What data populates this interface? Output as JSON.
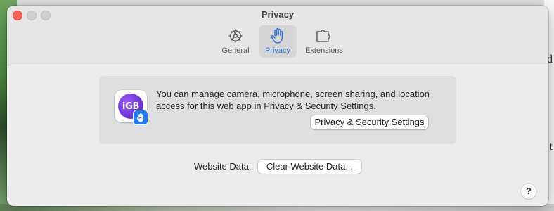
{
  "window": {
    "title": "Privacy"
  },
  "tabs": [
    {
      "label": "General",
      "icon": "gear-icon",
      "active": false
    },
    {
      "label": "Privacy",
      "icon": "hand-icon",
      "active": true
    },
    {
      "label": "Extensions",
      "icon": "puzzle-icon",
      "active": false
    }
  ],
  "privacy_info": {
    "app_icon_text": "iGB",
    "message": "You can manage camera, microphone, screen sharing, and location access for this web app in Privacy & Security Settings.",
    "settings_button": "Privacy & Security Settings"
  },
  "website_data": {
    "label": "Website Data:",
    "clear_button": "Clear Website Data..."
  },
  "help": {
    "label": "?"
  },
  "colors": {
    "accent": "#2a6fd6",
    "close": "#fe5f57",
    "app_icon": "#6d35d9",
    "badge": "#1f7cf3"
  }
}
